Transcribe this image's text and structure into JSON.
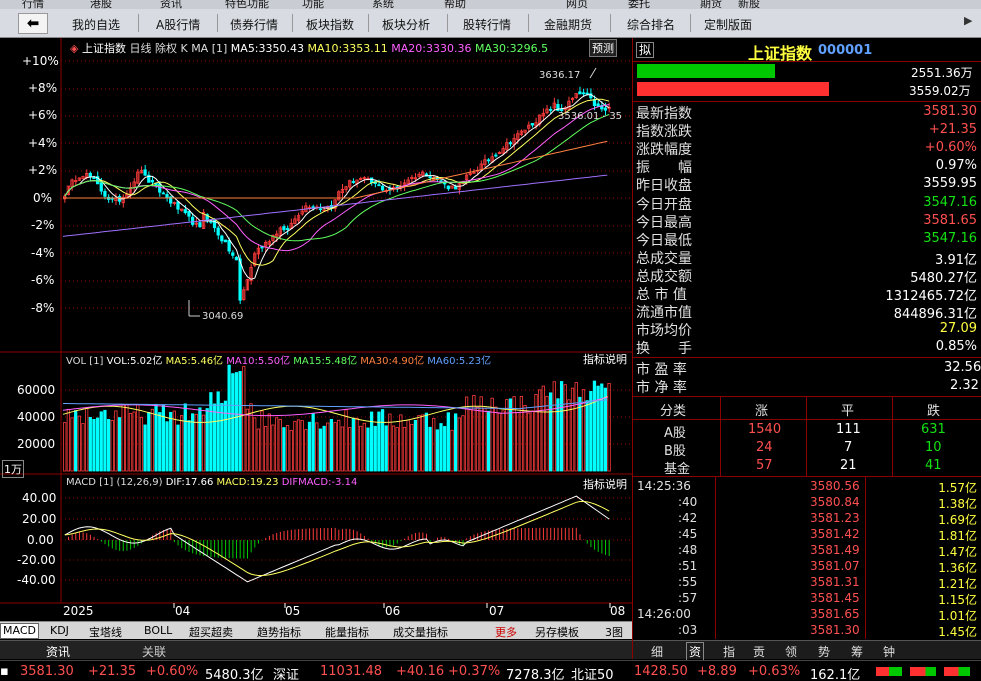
{
  "top_menu": [
    "行情",
    "港股",
    "资讯",
    "特色功能",
    "功能",
    "系统",
    "帮助",
    "网页",
    "委托",
    "期货",
    "新股"
  ],
  "nav": {
    "back_label": "⬅",
    "items": [
      "我的自选",
      "A股行情",
      "债券行情",
      "板块指数",
      "板块分析",
      "股转行情",
      "金融期货",
      "综合排名",
      "定制版面"
    ],
    "more": "▶"
  },
  "kline": {
    "title": "上证指数",
    "period": "日线",
    "adjust": "除权",
    "series_type": "K",
    "ma_label": "MA",
    "bracket": "[1]",
    "ma5": "MA5:3350.43",
    "ma10": "MA10:3353.11",
    "ma20": "MA20:3330.36",
    "ma30": "MA30:3296.5",
    "predict_label": "预测",
    "high_label": "3636.17",
    "low_label": "3040.69",
    "last_label": "3536.01 - 35",
    "y_ticks": [
      "+10%",
      "+8%",
      "+6%",
      "+4%",
      "+2%",
      "0%",
      "-2%",
      "-4%",
      "-6%",
      "-8%"
    ]
  },
  "volume": {
    "title": "VOL",
    "bracket": "[1]",
    "vol": "VOL:5.02亿",
    "ma5": "MA5:5.46亿",
    "ma10": "MA10:5.50亿",
    "ma15": "MA15:5.48亿",
    "ma30": "MA30:4.90亿",
    "ma60": "MA60:5.23亿",
    "help": "指标说明",
    "y_ticks": [
      "60000",
      "40000",
      "20000"
    ],
    "unit": "1万"
  },
  "macd": {
    "title": "MACD",
    "bracket": "[1]",
    "params": "(12,26,9)",
    "dif": "DIF:17.66",
    "macd": "MACD:19.23",
    "difmacd": "DIFMACD:-3.14",
    "help": "指标说明",
    "y_ticks": [
      "40.00",
      "20.00",
      "0.00",
      "-20.00",
      "-40.00"
    ]
  },
  "x_axis": [
    "2025",
    "04",
    "05",
    "06",
    "07",
    "08"
  ],
  "bottom_tabs": [
    "MACD",
    "KDJ",
    "宝塔线",
    "BOLL",
    "超买超卖",
    "趋势指标",
    "能量指标",
    "成交量指标",
    "更多",
    "另存模板",
    "3图"
  ],
  "news_tabs": [
    "资讯",
    "关联"
  ],
  "index_panel": {
    "icon": "拟",
    "name": "上证指数",
    "code": "000001",
    "buy_vol": "2551.36万",
    "sell_vol": "3559.02万",
    "buy_ratio": 0.417,
    "sell_ratio": 0.583,
    "rows": [
      {
        "label": "最新指数",
        "value": "3581.30",
        "color": "red"
      },
      {
        "label": "指数涨跌",
        "value": "+21.35",
        "color": "red"
      },
      {
        "label": "涨跌幅度",
        "value": "+0.60%",
        "color": "red"
      },
      {
        "label": "振　　幅",
        "value": "0.97%",
        "color": "white"
      },
      {
        "label": "昨日收盘",
        "value": "3559.95",
        "color": "white"
      },
      {
        "label": "今日开盘",
        "value": "3547.16",
        "color": "green"
      },
      {
        "label": "今日最高",
        "value": "3581.65",
        "color": "red"
      },
      {
        "label": "今日最低",
        "value": "3547.16",
        "color": "green"
      },
      {
        "label": "总成交量",
        "value": "3.91亿",
        "color": "white"
      },
      {
        "label": "总成交额",
        "value": "5480.27亿",
        "color": "white"
      },
      {
        "label": "总 市 值",
        "value": "1312465.72亿",
        "color": "white"
      },
      {
        "label": "流通市值",
        "value": "844896.31亿",
        "color": "white"
      },
      {
        "label": "市场均价",
        "value": "27.09",
        "color": "yellow"
      },
      {
        "label": "换　　手",
        "value": "0.85%",
        "color": "white"
      }
    ],
    "pe_label": "市 盈 率",
    "pe_value": "32.56",
    "pb_label": "市 净 率",
    "pb_value": "2.32",
    "table_head": [
      "分类",
      "涨",
      "平",
      "跌"
    ],
    "table_rows": [
      {
        "cat": "A股",
        "up": "1540",
        "flat": "111",
        "down": "631"
      },
      {
        "cat": "B股",
        "up": "24",
        "flat": "7",
        "down": "10"
      },
      {
        "cat": "基金",
        "up": "57",
        "flat": "21",
        "down": "41"
      }
    ]
  },
  "ticks": [
    {
      "time": "14:25:36",
      "price": "3580.56",
      "vol": "1.57亿"
    },
    {
      "time": ":40",
      "price": "3580.84",
      "vol": "1.38亿"
    },
    {
      "time": ":42",
      "price": "3581.23",
      "vol": "1.69亿"
    },
    {
      "time": ":45",
      "price": "3581.42",
      "vol": "1.81亿"
    },
    {
      "time": ":48",
      "price": "3581.49",
      "vol": "1.47亿"
    },
    {
      "time": ":51",
      "price": "3581.07",
      "vol": "1.36亿"
    },
    {
      "time": ":55",
      "price": "3581.31",
      "vol": "1.21亿"
    },
    {
      "time": ":57",
      "price": "3581.45",
      "vol": "1.15亿"
    },
    {
      "time": "14:26:00",
      "price": "3581.65",
      "vol": "1.01亿"
    },
    {
      "time": ":03",
      "price": "3581.30",
      "vol": "1.45亿"
    }
  ],
  "right_tabs": [
    "细",
    "资",
    "指",
    "贡",
    "领",
    "势",
    "筹",
    "钟"
  ],
  "status": {
    "sh_price": "3581.30",
    "sh_chg": "+21.35",
    "sh_pct": "+0.60%",
    "sh_amt": "5480.3亿",
    "sz_name": "深证",
    "sz_price": "11031.48",
    "sz_chg": "+40.16",
    "sz_pct": "+0.37%",
    "sz_amt": "7278.3亿",
    "bz_name": "北证50",
    "bz_price": "1428.50",
    "bz_chg": "+8.89",
    "bz_pct": "+0.63%",
    "bz_amt": "162.1亿"
  },
  "colors": {
    "up": "#ff3c3c",
    "down": "#00ffff",
    "macd_down": "#00c800",
    "grid": "#8b0000",
    "bg": "#000000"
  }
}
